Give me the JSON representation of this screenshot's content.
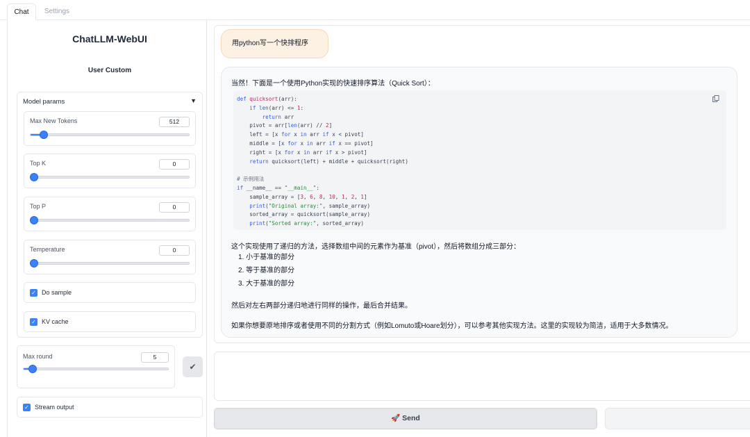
{
  "tabs": [
    {
      "label": "Chat",
      "active": true
    },
    {
      "label": "Settings",
      "active": false
    }
  ],
  "sidebar": {
    "title": "ChatLLM-WebUI",
    "subtitle": "User Custom",
    "model_params": {
      "header": "Model params",
      "sliders": [
        {
          "label": "Max New Tokens",
          "value": "512",
          "fill_fraction": 0.06
        },
        {
          "label": "Top K",
          "value": "0",
          "fill_fraction": 0.0
        },
        {
          "label": "Top P",
          "value": "0",
          "fill_fraction": 0.0
        },
        {
          "label": "Temperature",
          "value": "0",
          "fill_fraction": 0.0
        }
      ],
      "checkboxes": [
        {
          "label": "Do sample",
          "checked": true
        },
        {
          "label": "KV cache",
          "checked": true
        }
      ]
    },
    "max_round": {
      "label": "Max round",
      "value": "5",
      "fill_fraction": 0.04
    },
    "confirm_icon": "check-icon",
    "stream_output": {
      "label": "Stream output",
      "checked": true
    }
  },
  "chat": {
    "user_message": "用python写一个快排程序",
    "bot": {
      "intro": "当然！下面是一个使用Python实现的快速排序算法（Quick Sort）：",
      "paragraph1": "这个实现使用了递归的方法，选择数组中间的元素作为基准（pivot），然后将数组分成三部分：",
      "list": [
        "1. 小于基准的部分",
        "2. 等于基准的部分",
        "3. 大于基准的部分"
      ],
      "paragraph2": "然后对左右两部分递归地进行同样的操作，最后合并结果。",
      "paragraph3": "如果你想要原地排序或者使用不同的分割方式（例如Lomuto或Hoare划分），可以参考其他实现方法。这里的实现较为简洁，适用于大多数情况。"
    }
  },
  "send_button": {
    "icon": "rocket-icon",
    "label": "🚀 Send"
  }
}
